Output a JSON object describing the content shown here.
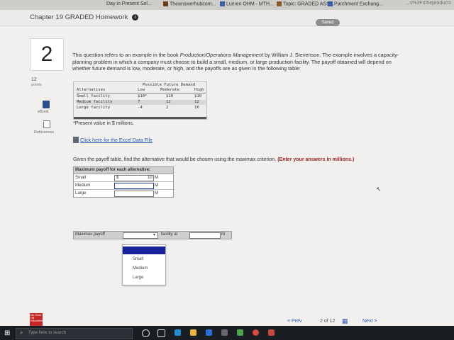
{
  "browser": {
    "tabs": [
      {
        "label": "Day in Present Sol..."
      },
      {
        "label": "Theanswerhubcom..."
      },
      {
        "label": "Lumen OHM - MTH..."
      },
      {
        "label": "Topic: GRADED ASS..."
      },
      {
        "label": "Parchment Exchang..."
      }
    ],
    "url_fragment": "...s%2Fmheproducts"
  },
  "header": {
    "chapter_title": "Chapter 19 GRADED Homework",
    "info_symbol": "i",
    "saved_label": "Saved"
  },
  "question": {
    "number": "2",
    "points_value": "12",
    "points_label": "points",
    "text_intro": "This question refers to an example in the book ",
    "text_book": "Production/Operations Management",
    "text_rest": " by William J. Stevenson. The example involves a capacity-planning problem in which a company must choose to build a small, medium, or large production facility. The payoff obtained will depend on whether future demand is low, moderate, or high, and the payoffs are as given in the following table:"
  },
  "sidebar": {
    "ebook_label": "eBook",
    "references_label": "References"
  },
  "payoff_table": {
    "header": "Possible Future Demand",
    "columns": [
      "Alternatives",
      "Low",
      "Moderate",
      "High"
    ],
    "rows": [
      [
        "Small facility",
        "$10*",
        "$10",
        "$10"
      ],
      [
        "Medium facility",
        "7",
        "12",
        "12"
      ],
      [
        "Large facility",
        "-4",
        "2",
        "16"
      ]
    ]
  },
  "footnote": "*Present value in $ millions.",
  "excel_link": "Click here for the Excel Data File",
  "instruction": {
    "text": "Given the payoff table, find the alternative that would be chosen using the maximax criterion. ",
    "emphasis": "(Enter your answers in millions.)"
  },
  "answer_table": {
    "header": "Maximum payoff for each alternative:",
    "rows": [
      {
        "label": "Small",
        "dollar": "$",
        "value": "10",
        "unit": "M"
      },
      {
        "label": "Medium",
        "dollar": "",
        "value": "",
        "unit": "M"
      },
      {
        "label": "Large",
        "dollar": "",
        "value": "",
        "unit": "M"
      }
    ]
  },
  "maximax": {
    "label": "Maximax payoff",
    "selected": "",
    "caret": "▼",
    "at_label": "facility at",
    "amount": "",
    "unit": "M",
    "options": [
      "",
      "Small",
      "Medium",
      "Large"
    ]
  },
  "footer": {
    "logo_text": "Mc Graw Hill Education",
    "prev_label": "< Prev",
    "page_current": "2",
    "page_total": "12",
    "page_sep": "of",
    "next_label": "Next >"
  },
  "taskbar": {
    "search_placeholder": "Type here to search"
  },
  "colors": {
    "link": "#2c58b0",
    "emphasis": "#a02020",
    "dropdown_selected": "#17219c"
  }
}
